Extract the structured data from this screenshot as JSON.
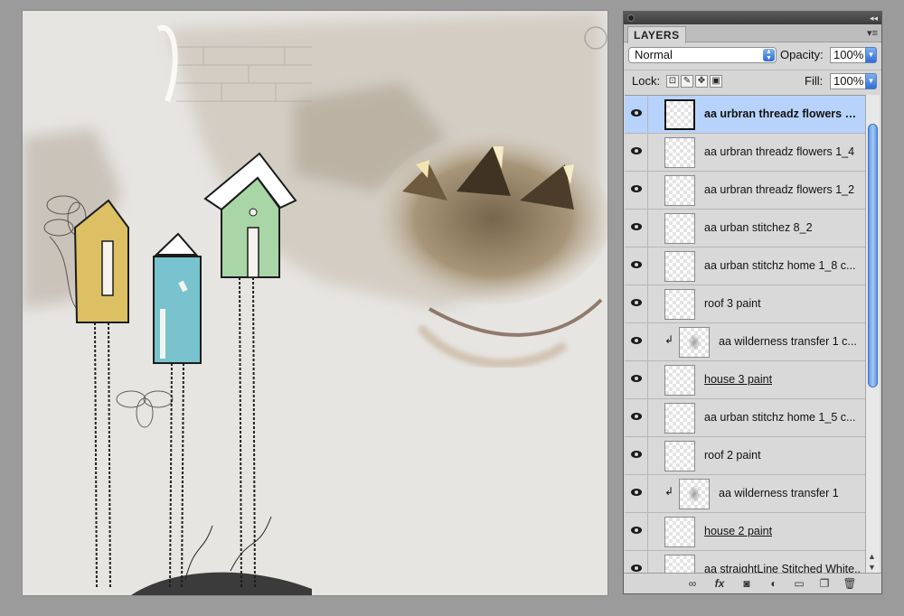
{
  "panel": {
    "tab_label": "LAYERS",
    "menu_icon": "panel-menu-icon",
    "collapse_icon": "collapse-icon",
    "blend_mode": "Normal",
    "opacity_label": "Opacity:",
    "opacity_value": "100%",
    "lock_label": "Lock:",
    "fill_label": "Fill:",
    "fill_value": "100%"
  },
  "layers": [
    {
      "name": "aa urbran threadz flowers …",
      "visible": true,
      "selected": true,
      "clipped": false,
      "underline": false
    },
    {
      "name": "aa urbran threadz flowers 1_4",
      "visible": true,
      "selected": false,
      "clipped": false,
      "underline": false
    },
    {
      "name": "aa urbran threadz flowers 1_2",
      "visible": true,
      "selected": false,
      "clipped": false,
      "underline": false
    },
    {
      "name": "aa urban stitchez 8_2",
      "visible": true,
      "selected": false,
      "clipped": false,
      "underline": false
    },
    {
      "name": "aa urban stitchz home 1_8 c...",
      "visible": true,
      "selected": false,
      "clipped": false,
      "underline": false
    },
    {
      "name": "roof 3 paint",
      "visible": true,
      "selected": false,
      "clipped": false,
      "underline": false
    },
    {
      "name": "aa wilderness transfer 1 c...",
      "visible": true,
      "selected": false,
      "clipped": true,
      "underline": false
    },
    {
      "name": "house 3 paint",
      "visible": true,
      "selected": false,
      "clipped": false,
      "underline": true
    },
    {
      "name": "aa urban stitchz home 1_5 c...",
      "visible": true,
      "selected": false,
      "clipped": false,
      "underline": false
    },
    {
      "name": "roof 2 paint",
      "visible": true,
      "selected": false,
      "clipped": false,
      "underline": false
    },
    {
      "name": "aa wilderness transfer 1",
      "visible": true,
      "selected": false,
      "clipped": true,
      "underline": false
    },
    {
      "name": "house 2 paint",
      "visible": true,
      "selected": false,
      "clipped": false,
      "underline": true
    },
    {
      "name": "aa straightLine Stitched White...",
      "visible": true,
      "selected": false,
      "clipped": false,
      "underline": false
    }
  ],
  "footer_icons": [
    "link-layers-icon",
    "fx-icon",
    "add-mask-icon",
    "adjustment-layer-icon",
    "new-group-icon",
    "new-layer-icon",
    "trash-icon"
  ],
  "colors": {
    "selection": "#b7d3fb",
    "house_yellow": "#dcc063",
    "house_blue": "#78c3cd",
    "house_green": "#a8d6a6",
    "scroll_blue": "#5d98e6"
  }
}
